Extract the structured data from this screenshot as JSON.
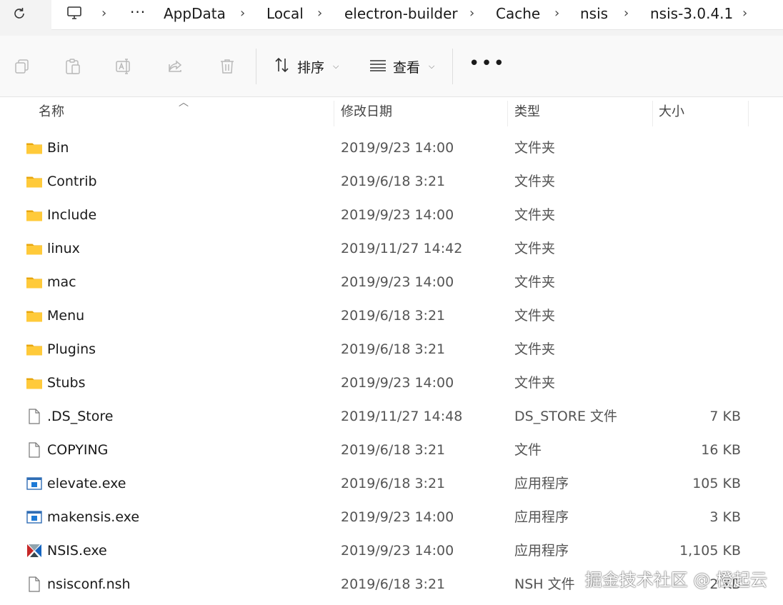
{
  "breadcrumb": {
    "ellipsis": "···",
    "items": [
      "AppData",
      "Local",
      "electron-builder",
      "Cache",
      "nsis",
      "nsis-3.0.4.1"
    ]
  },
  "toolbar": {
    "sort_label": "排序",
    "view_label": "查看",
    "more_label": "•••"
  },
  "columns": {
    "name": "名称",
    "date": "修改日期",
    "type": "类型",
    "size": "大小"
  },
  "files": [
    {
      "name": "Bin",
      "date": "2019/9/23 14:00",
      "type": "文件夹",
      "size": "",
      "icon": "folder-icon"
    },
    {
      "name": "Contrib",
      "date": "2019/6/18 3:21",
      "type": "文件夹",
      "size": "",
      "icon": "folder-icon"
    },
    {
      "name": "Include",
      "date": "2019/9/23 14:00",
      "type": "文件夹",
      "size": "",
      "icon": "folder-icon"
    },
    {
      "name": "linux",
      "date": "2019/11/27 14:42",
      "type": "文件夹",
      "size": "",
      "icon": "folder-icon"
    },
    {
      "name": "mac",
      "date": "2019/9/23 14:00",
      "type": "文件夹",
      "size": "",
      "icon": "folder-icon"
    },
    {
      "name": "Menu",
      "date": "2019/6/18 3:21",
      "type": "文件夹",
      "size": "",
      "icon": "folder-icon"
    },
    {
      "name": "Plugins",
      "date": "2019/6/18 3:21",
      "type": "文件夹",
      "size": "",
      "icon": "folder-icon"
    },
    {
      "name": "Stubs",
      "date": "2019/9/23 14:00",
      "type": "文件夹",
      "size": "",
      "icon": "folder-icon"
    },
    {
      "name": ".DS_Store",
      "date": "2019/11/27 14:48",
      "type": "DS_STORE 文件",
      "size": "7 KB",
      "icon": "file-icon"
    },
    {
      "name": "COPYING",
      "date": "2019/6/18 3:21",
      "type": "文件",
      "size": "16 KB",
      "icon": "file-icon"
    },
    {
      "name": "elevate.exe",
      "date": "2019/6/18 3:21",
      "type": "应用程序",
      "size": "105 KB",
      "icon": "app-icon"
    },
    {
      "name": "makensis.exe",
      "date": "2019/9/23 14:00",
      "type": "应用程序",
      "size": "3 KB",
      "icon": "app-icon"
    },
    {
      "name": "NSIS.exe",
      "date": "2019/9/23 14:00",
      "type": "应用程序",
      "size": "1,105 KB",
      "icon": "nsis-icon"
    },
    {
      "name": "nsisconf.nsh",
      "date": "2019/6/18 3:21",
      "type": "NSH 文件",
      "size": "2 KB",
      "icon": "file-icon"
    }
  ],
  "watermark": "掘金技术社区 @ 橙起云"
}
